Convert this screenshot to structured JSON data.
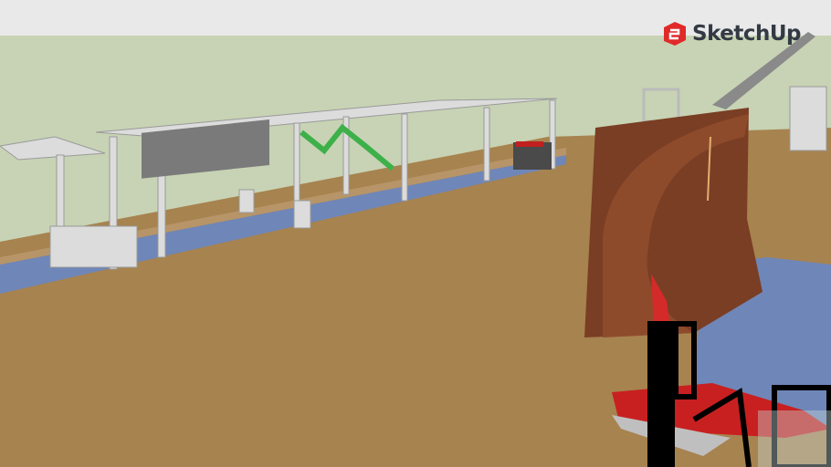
{
  "viewer": {
    "brand_logo_text": "SketchUp",
    "colors": {
      "sky": "#e9e9e9",
      "horizon": "#c7d3b4",
      "ground": "#a7834f",
      "water": "#6f86b8",
      "ramp": "#7a3e24",
      "accent_red": "#d42a2a",
      "structure": "#d8d8d8"
    }
  }
}
